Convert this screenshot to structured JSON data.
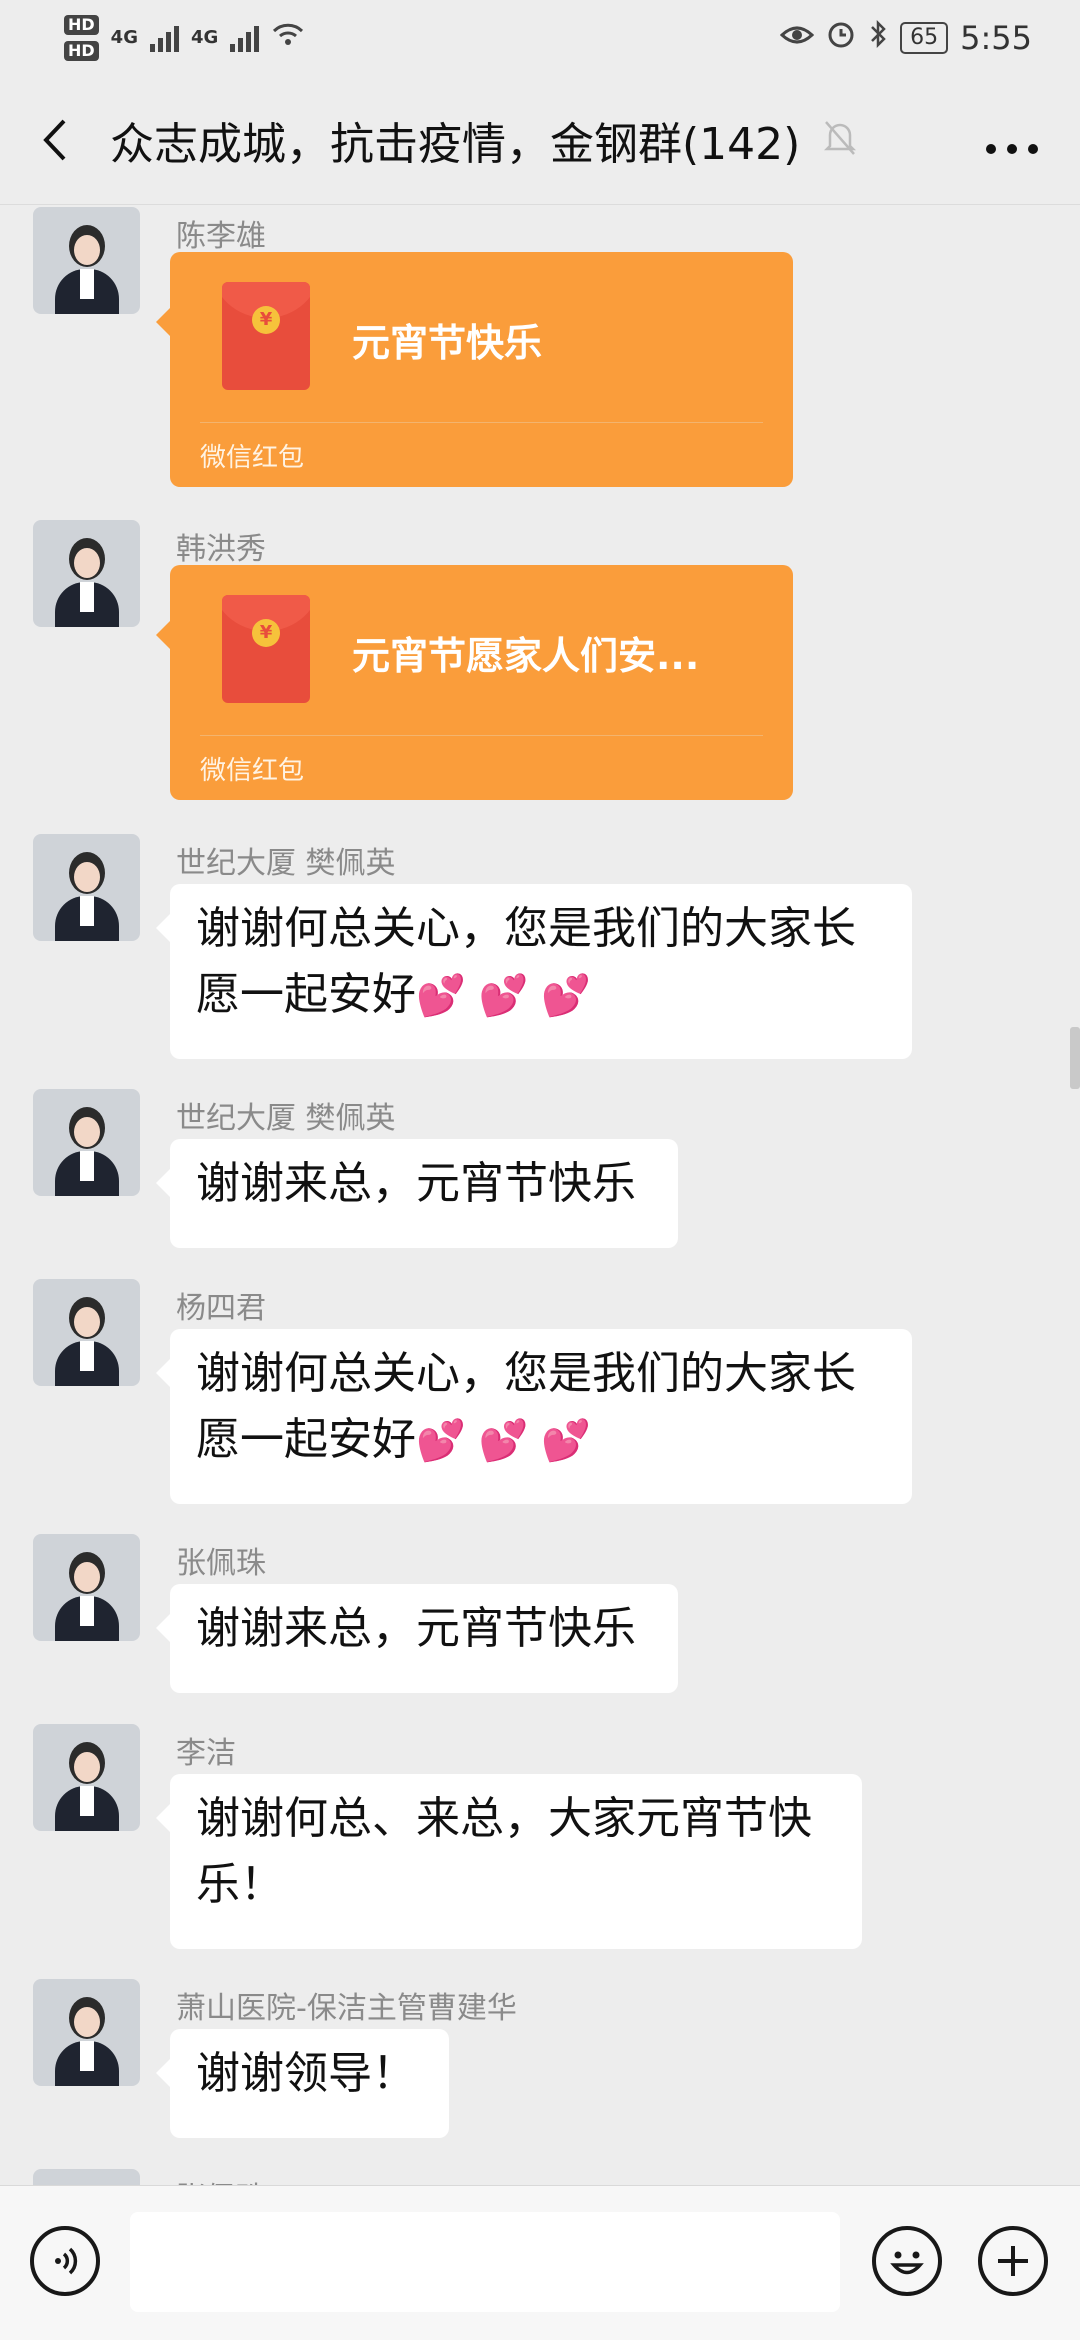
{
  "status_bar": {
    "hd1": "HD",
    "hd2": "HD",
    "net1": "4G",
    "net2": "4G",
    "battery": "65",
    "time": "5:55",
    "icons": [
      "eye-icon",
      "alarm-icon",
      "bluetooth-icon"
    ]
  },
  "header": {
    "title": "众志成城，抗击疫情，金钢群(142)",
    "icons": [
      "back-icon",
      "mute-bell-icon",
      "more-icon"
    ]
  },
  "messages": [
    {
      "sender": "陈李雄",
      "type": "red_packet",
      "title": "元宵节快乐",
      "footer": "微信红包"
    },
    {
      "sender": "韩洪秀",
      "type": "red_packet",
      "title": "元宵节愿家人们安...",
      "footer": "微信红包"
    },
    {
      "sender": "世纪大厦 樊佩英",
      "type": "text",
      "lines": [
        "谢谢何总关心，您是我们的大家长",
        "愿一起安好"
      ],
      "emoji": "💕 💕 💕"
    },
    {
      "sender": "世纪大厦 樊佩英",
      "type": "text",
      "lines": [
        "谢谢来总，元宵节快乐"
      ]
    },
    {
      "sender": "杨四君",
      "type": "text",
      "lines": [
        "谢谢何总关心，您是我们的大家长",
        "愿一起安好"
      ],
      "emoji": "💕 💕 💕"
    },
    {
      "sender": "张佩珠",
      "type": "text",
      "lines": [
        "谢谢来总，元宵节快乐"
      ]
    },
    {
      "sender": "李洁",
      "type": "text",
      "lines": [
        "谢谢何总、来总，大家元宵节快",
        "乐！"
      ]
    },
    {
      "sender": "萧山医院-保洁主管曹建华",
      "type": "text",
      "lines": [
        "谢谢领导！"
      ]
    },
    {
      "sender": "张佩珠",
      "type": "partial"
    }
  ],
  "input_bar": {
    "placeholder": "",
    "icons": [
      "voice-icon",
      "emoji-icon",
      "plus-icon"
    ]
  },
  "colors": {
    "background": "#ededed",
    "bubble": "#ffffff",
    "red_packet": "#fa9d3b",
    "envelope": "#e84d3c"
  }
}
